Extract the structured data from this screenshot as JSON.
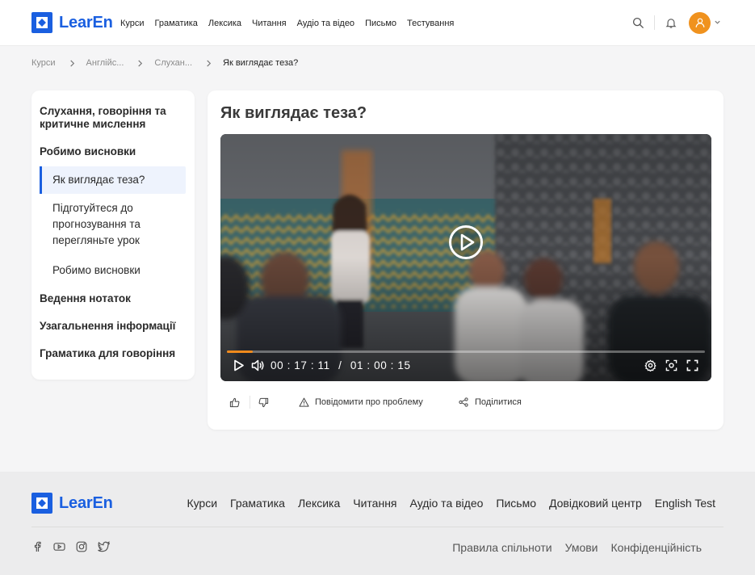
{
  "brand": {
    "name": "LearEn",
    "color": "#1a5fe0"
  },
  "nav": [
    "Курси",
    "Граматика",
    "Лексика",
    "Читання",
    "Аудіо та відео",
    "Письмо",
    "Тестування"
  ],
  "header_icons": [
    "search-icon",
    "bell-icon",
    "user-avatar",
    "chevron-down-icon"
  ],
  "breadcrumb": [
    "Курси",
    "Англійс...",
    "Слухан...",
    "Як виглядає теза?"
  ],
  "sidebar": {
    "title": "Слухання, говоріння та критичне мислення",
    "section1": "Робимо висновки",
    "items": [
      "Як виглядає теза?",
      "Підготуйтеся до прогнозування та перегляньте урок",
      "Робимо висновки"
    ],
    "sections": [
      "Ведення нотаток",
      "Узагальнення інформації",
      "Граматика для говоріння"
    ]
  },
  "lesson": {
    "title": "Як виглядає теза?",
    "video": {
      "current_time": "00:17:11",
      "duration": "01:00:15",
      "time_separator": "/",
      "progress": 0.054,
      "progress_color": "#f08a1c"
    },
    "actions": {
      "report": "Повідомити про проблему",
      "share": "Поділитися"
    }
  },
  "footer": {
    "nav": [
      "Курси",
      "Граматика",
      "Лексика",
      "Читання",
      "Аудіо та відео",
      "Письмо",
      "Довідковий центр",
      "English Test"
    ],
    "social": [
      "facebook-icon",
      "youtube-icon",
      "instagram-icon",
      "twitter-icon"
    ],
    "links": [
      "Правила спільноти",
      "Умови",
      "Конфіденційність"
    ]
  }
}
